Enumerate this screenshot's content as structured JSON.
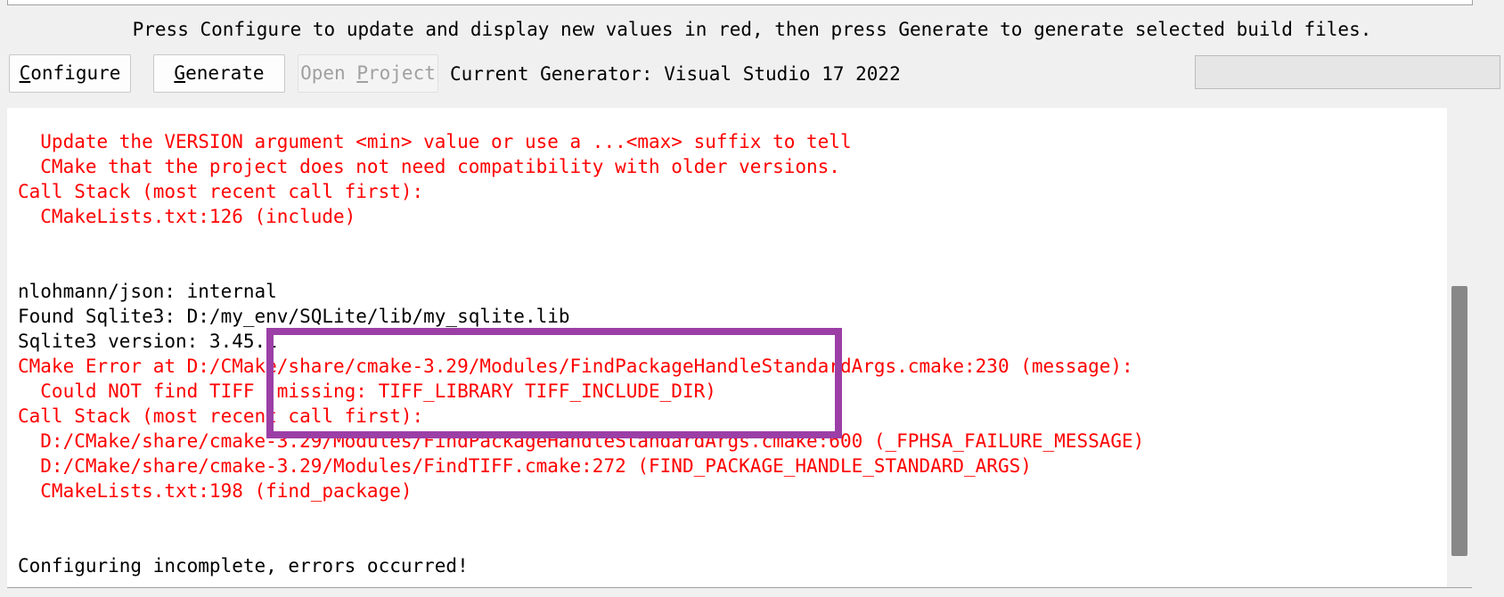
{
  "hint_text": "Press Configure to update and display new values in red, then press Generate to generate selected build files.",
  "buttons": {
    "configure": {
      "pre": "",
      "accel": "C",
      "post": "onfigure"
    },
    "generate": {
      "pre": "",
      "accel": "G",
      "post": "enerate"
    },
    "open_project": {
      "pre": "Open ",
      "accel": "P",
      "post": "roject"
    }
  },
  "generator_label": "Current Generator: Visual Studio 17 2022",
  "output_lines": [
    {
      "text": "  Update the VERSION argument <min> value or use a ...<max> suffix to tell",
      "color": "red"
    },
    {
      "text": "  CMake that the project does not need compatibility with older versions.",
      "color": "red"
    },
    {
      "text": "Call Stack (most recent call first):",
      "color": "red"
    },
    {
      "text": "  CMakeLists.txt:126 (include)",
      "color": "red"
    },
    {
      "text": "",
      "color": "black"
    },
    {
      "text": "",
      "color": "black"
    },
    {
      "text": "nlohmann/json: internal",
      "color": "black"
    },
    {
      "text": "Found Sqlite3: D:/my_env/SQLite/lib/my_sqlite.lib",
      "color": "black"
    },
    {
      "text": "Sqlite3 version: 3.45.1",
      "color": "black"
    },
    {
      "text": "CMake Error at D:/CMake/share/cmake-3.29/Modules/FindPackageHandleStandardArgs.cmake:230 (message):",
      "color": "red"
    },
    {
      "text": "  Could NOT find TIFF (missing: TIFF_LIBRARY TIFF_INCLUDE_DIR)",
      "color": "red"
    },
    {
      "text": "Call Stack (most recent call first):",
      "color": "red"
    },
    {
      "text": "  D:/CMake/share/cmake-3.29/Modules/FindPackageHandleStandardArgs.cmake:600 (_FPHSA_FAILURE_MESSAGE)",
      "color": "red"
    },
    {
      "text": "  D:/CMake/share/cmake-3.29/Modules/FindTIFF.cmake:272 (FIND_PACKAGE_HANDLE_STANDARD_ARGS)",
      "color": "red"
    },
    {
      "text": "  CMakeLists.txt:198 (find_package)",
      "color": "red"
    },
    {
      "text": "",
      "color": "black"
    },
    {
      "text": "",
      "color": "black"
    },
    {
      "text": "Configuring incomplete, errors occurred!",
      "color": "black"
    }
  ],
  "colors": {
    "error_text": "#ff0000",
    "normal_text": "#000000",
    "highlight_box": "#9b3fa6"
  }
}
